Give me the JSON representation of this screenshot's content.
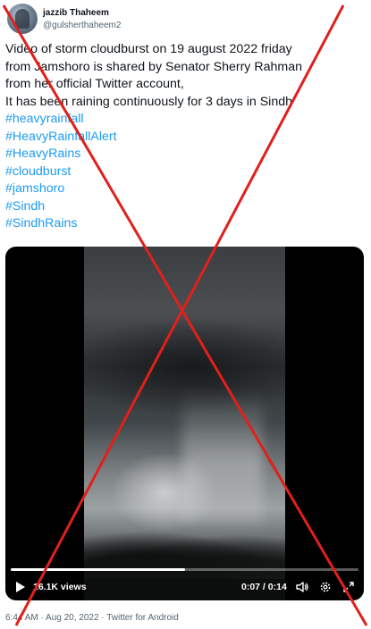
{
  "author": {
    "name": "jazzib Thaheem",
    "handle": "@gulsherthaheem2",
    "avatar_icon": "profile-avatar"
  },
  "tweet": {
    "lines": [
      "Video of storm cloudburst on 19 august 2022 friday",
      "from Jamshoro is shared by Senator Sherry Rahman",
      "from her official Twitter account,",
      "It has been raining continuously for 3 days in Sindh"
    ],
    "hashtags": [
      "#heavyrainfall",
      "#HeavyRainfallAlert",
      "#HeavyRains",
      "#cloudburst",
      "#jamshoro",
      "#Sindh",
      "#SindhRains"
    ]
  },
  "video": {
    "views": "16.1K views",
    "time": "0:07 / 0:14",
    "progress": 0.5,
    "icons": [
      "play-icon",
      "volume-icon",
      "settings-gear-icon",
      "fullscreen-icon"
    ]
  },
  "footer": {
    "meta": "6:44 AM · Aug 20, 2022 · Twitter for Android"
  },
  "overlay": {
    "mark": "red-x-cross",
    "color": "#e0201b"
  },
  "colors": {
    "link": "#1d9bf0",
    "text": "#0f1419",
    "muted": "#536471"
  }
}
